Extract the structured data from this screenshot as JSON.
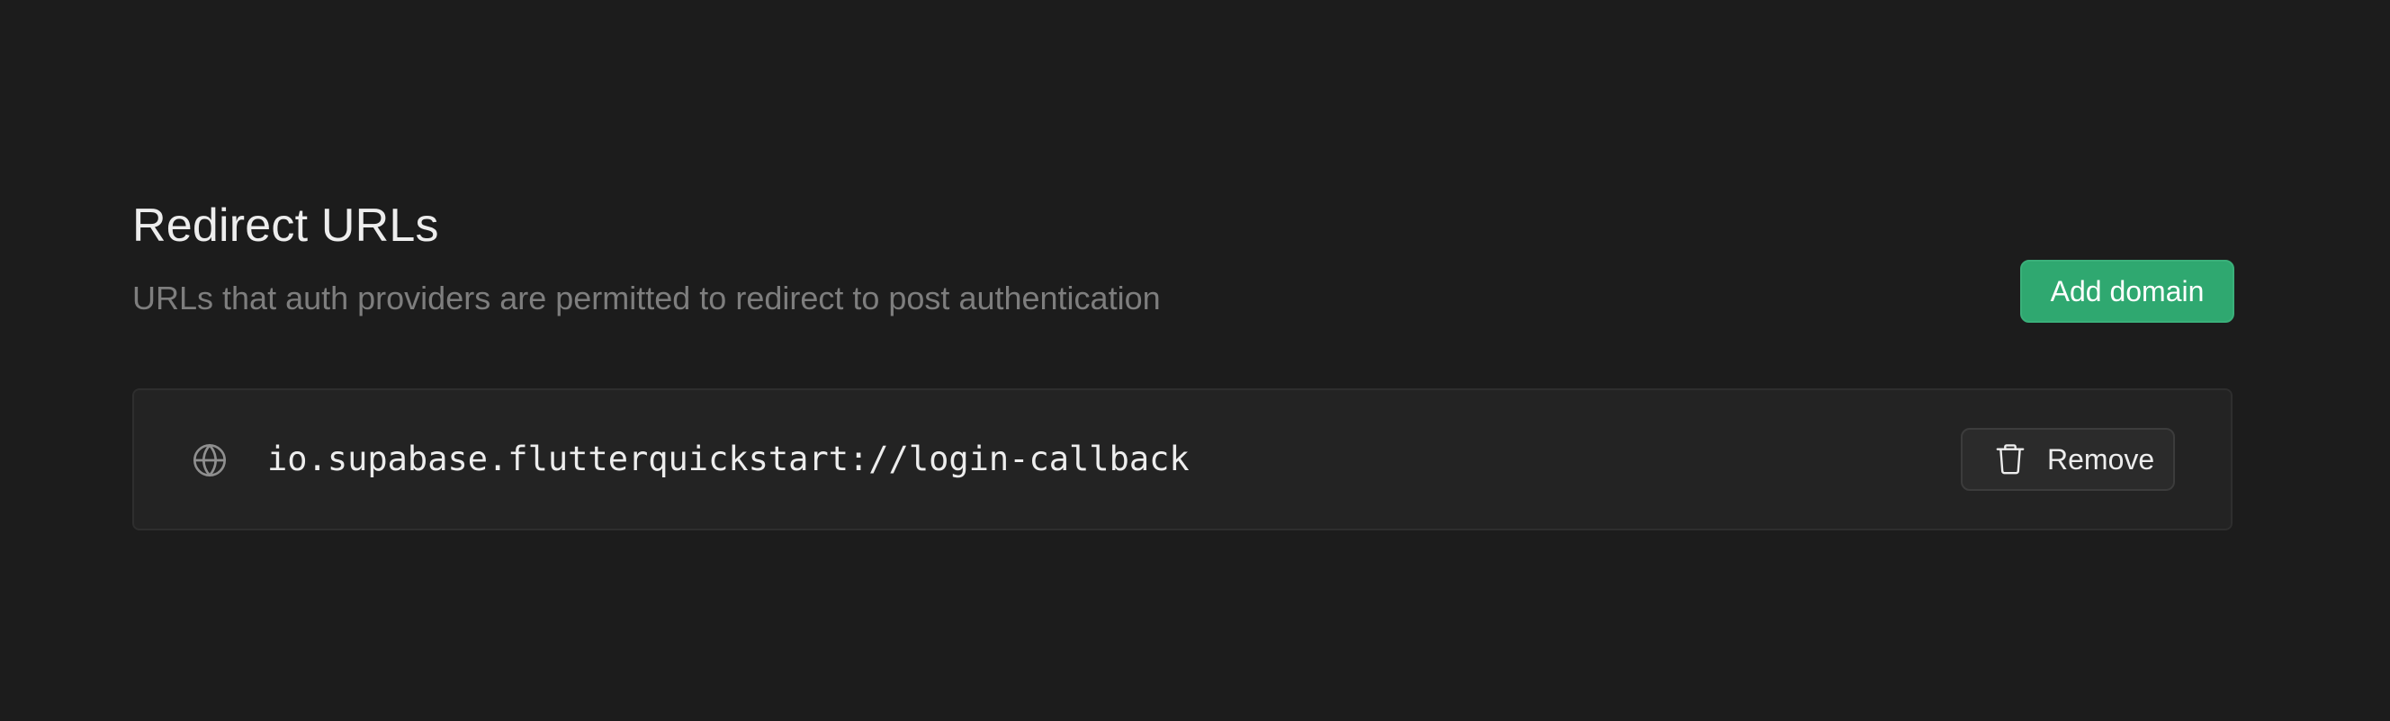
{
  "section": {
    "title": "Redirect URLs",
    "description": "URLs that auth providers are permitted to redirect to post authentication"
  },
  "actions": {
    "add_domain_label": "Add domain"
  },
  "urls": [
    {
      "icon": "globe-icon",
      "value": "io.supabase.flutterquickstart://login-callback",
      "remove_label": "Remove",
      "remove_icon": "trash-icon"
    }
  ],
  "colors": {
    "background": "#1c1c1c",
    "accent": "#2fa870",
    "muted_text": "#7e7e7e"
  }
}
